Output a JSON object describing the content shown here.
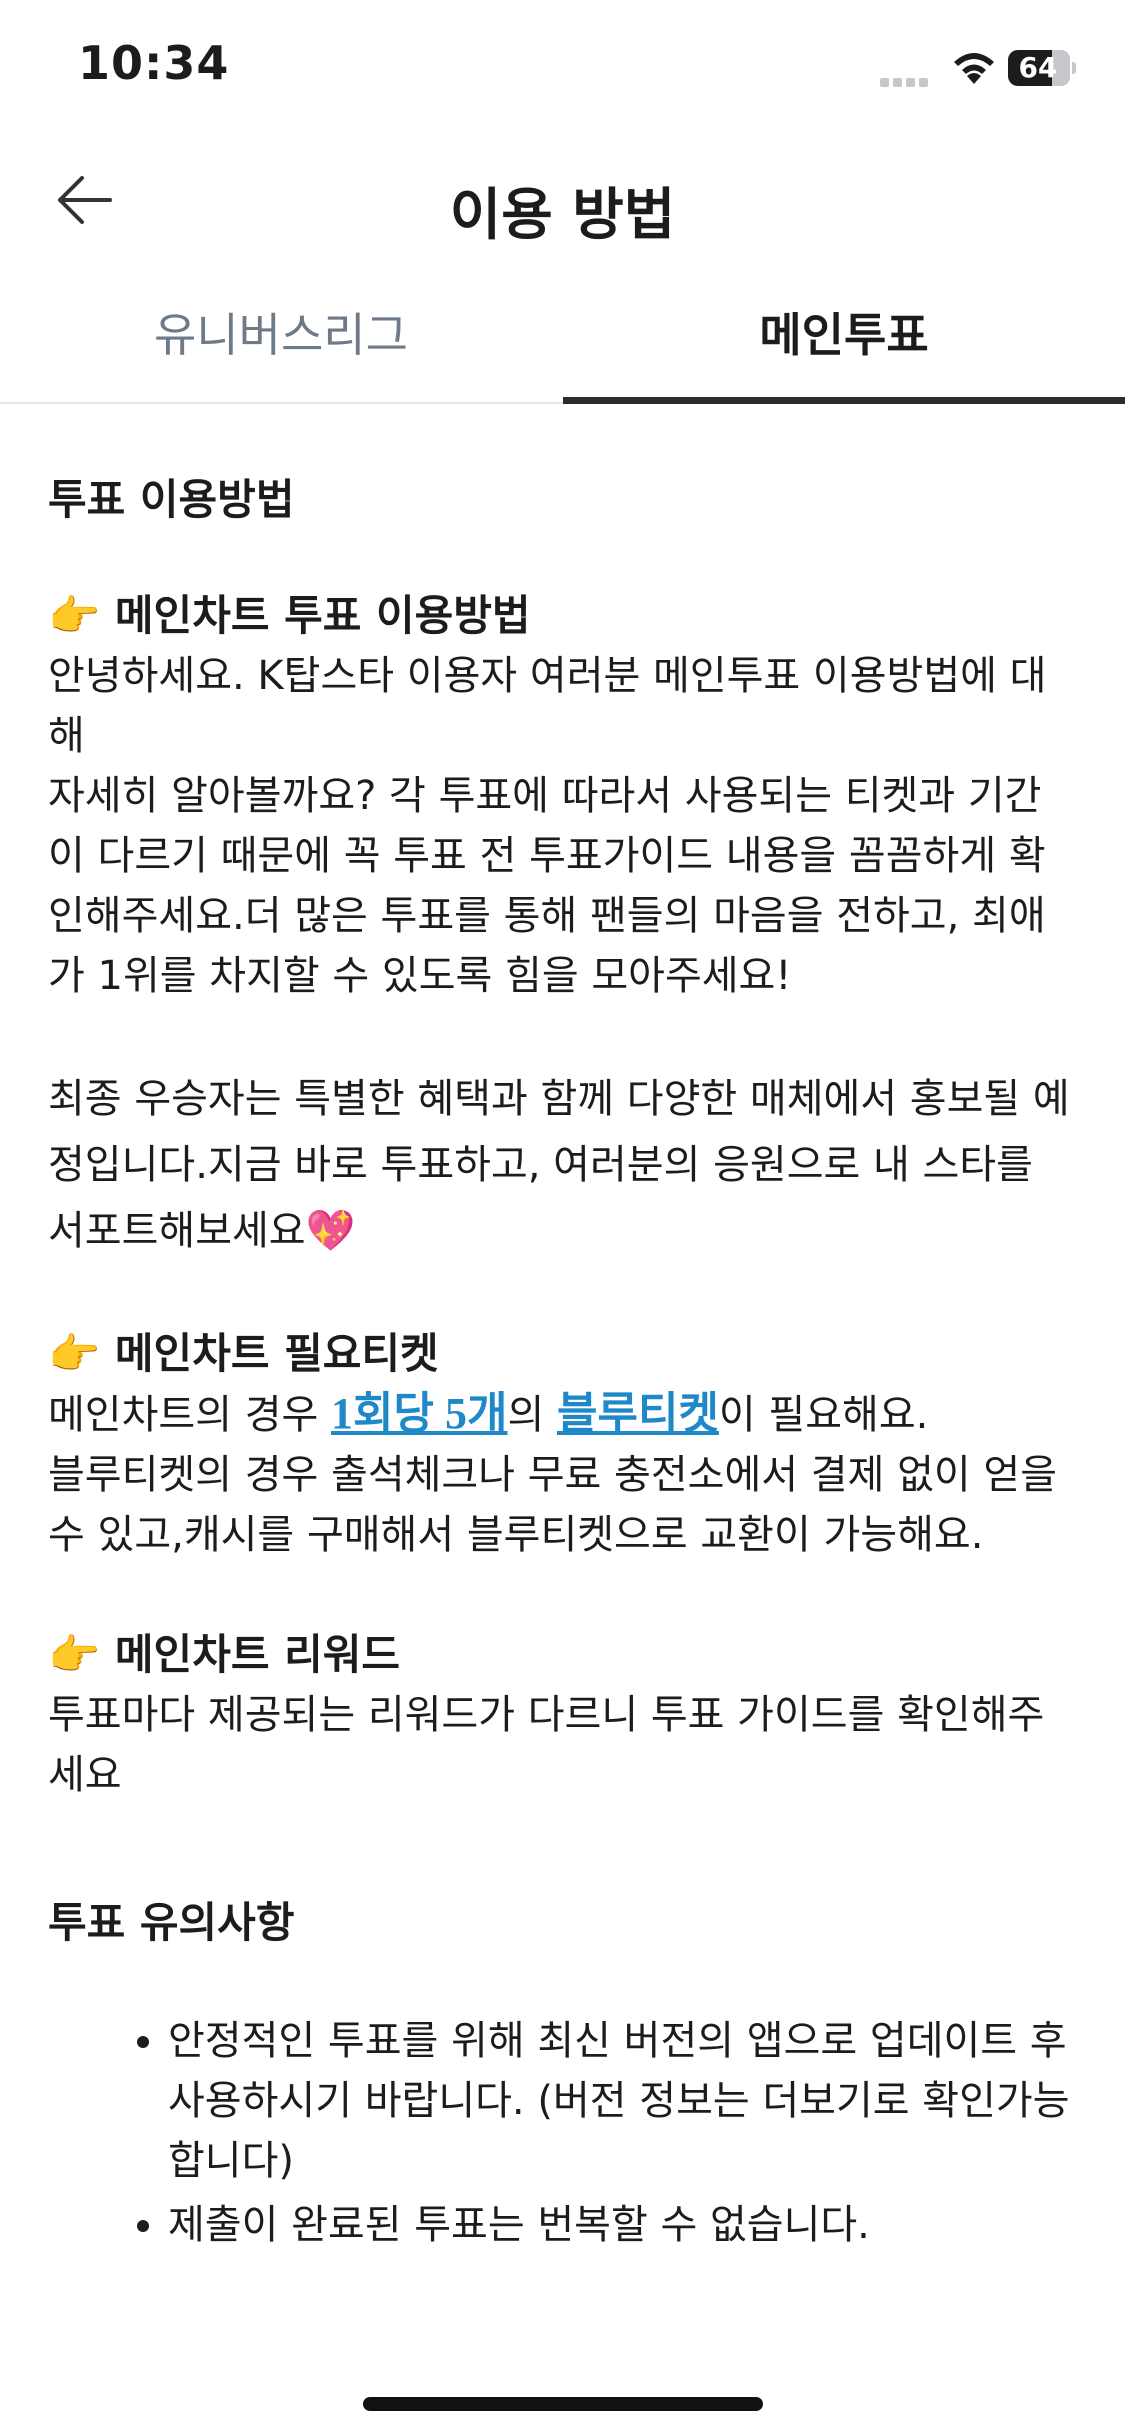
{
  "status": {
    "time": "10:34",
    "battery": "64"
  },
  "nav": {
    "title": "이용 방법"
  },
  "tabs": [
    {
      "label": "유니버스리그"
    },
    {
      "label": "메인투표"
    }
  ],
  "content": {
    "section_title": "투표 이용방법",
    "s1": {
      "title": "👉 메인차트 투표 이용방법",
      "p1": "안녕하세요. K탑스타 이용자 여러분 메인투표 이용방법에 대해",
      "p2": "자세히 알아볼까요? 각 투표에 따라서 사용되는 티켓과 기간이 다르기 때문에 꼭 투표 전 투표가이드 내용을 꼼꼼하게 확인해주세요.더 많은 투표를 통해 팬들의 마음을 전하고, 최애가 1위를 차지할 수 있도록 힘을 모아주세요!",
      "p3": "최종 우승자는 특별한 혜택과 함께 다양한 매체에서 홍보될 예정입니다.지금 바로 투표하고, 여러분의 응원으로 내 스타를 서포트해보세요💖"
    },
    "s2": {
      "title": "👉 메인차트 필요티켓",
      "t1": "메인차트의 경우 ",
      "link1": "1회당 5개",
      "t2": "의 ",
      "link2": "블루티켓",
      "t3": "이 필요해요.",
      "p2": "블루티켓의 경우 출석체크나 무료 충전소에서 결제 없이 얻을 수 있고,캐시를 구매해서 블루티켓으로 교환이 가능해요."
    },
    "s3": {
      "title": "👉 메인차트 리워드",
      "p1": "투표마다 제공되는 리워드가 다르니 투표 가이드를 확인해주세요"
    },
    "notice_title": "투표 유의사항",
    "notices": [
      "안정적인 투표를 위해 최신 버전의 앱으로 업데이트 후 사용하시기 바랍니다. (버전 정보는 더보기로 확인가능합니다)",
      "제출이 완료된 투표는 번복할 수 없습니다."
    ]
  }
}
